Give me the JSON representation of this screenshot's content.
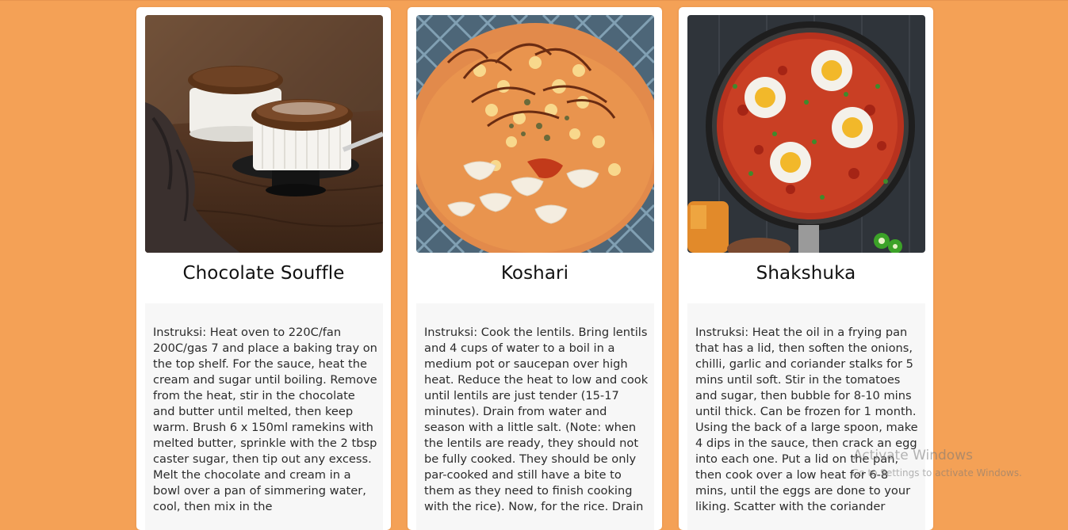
{
  "recipes": [
    {
      "image": "chocolate-souffle-photo",
      "title": "Chocolate Souffle",
      "instructions": "Instruksi: Heat oven to 220C/fan 200C/gas 7 and place a baking tray on the top shelf. For the sauce, heat the cream and sugar until boiling. Remove from the heat, stir in the chocolate and butter until melted, then keep warm. Brush 6 x 150ml ramekins with melted butter, sprinkle with the 2 tbsp caster sugar, then tip out any excess. Melt the chocolate and cream in a bowl over a pan of simmering water, cool, then mix in the"
    },
    {
      "image": "koshari-photo",
      "title": "Koshari",
      "instructions": "Instruksi: Cook the lentils. Bring lentils and 4 cups of water to a boil in a medium pot or saucepan over high heat. Reduce the heat to low and cook until lentils are just tender (15-17 minutes). Drain from water and season with a little salt. (Note: when the lentils are ready, they should not be fully cooked. They should be only par-cooked and still have a bite to them as they need to finish cooking with the rice). Now, for the rice. Drain"
    },
    {
      "image": "shakshuka-photo",
      "title": "Shakshuka",
      "instructions": "Instruksi: Heat the oil in a frying pan that has a lid, then soften the onions, chilli, garlic and coriander stalks for 5 mins until soft. Stir in the tomatoes and sugar, then bubble for 8-10 mins until thick. Can be frozen for 1 month. Using the back of a large spoon, make 4 dips in the sauce, then crack an egg into each one. Put a lid on the pan, then cook over a low heat for 6-8 mins, until the eggs are done to your liking. Scatter with the coriander"
    }
  ],
  "watermark": {
    "title": "Activate Windows",
    "subtitle": "Go to Settings to activate Windows."
  },
  "colors": {
    "background": "#f4a156",
    "card": "#ffffff",
    "body_panel": "#f7f7f7"
  }
}
